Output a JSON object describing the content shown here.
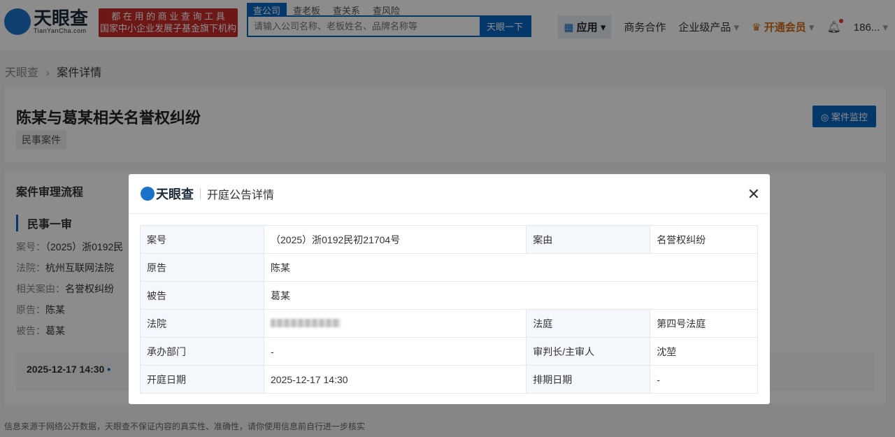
{
  "header": {
    "logo": "天眼查",
    "logo_sub": "TianYanCha.com",
    "slogan": [
      "都 在 用 的 商 业 查 询 工 具",
      "国家中小企业发展子基金旗下机构"
    ],
    "search_tabs": [
      "查公司",
      "查老板",
      "查关系",
      "查风险"
    ],
    "search_placeholder": "请输入公司名称、老板姓名、品牌名称等",
    "search_button": "天眼一下",
    "nav": {
      "app": "应用",
      "business": "商务合作",
      "enterprise": "企业级产品",
      "vip": "开通会员",
      "user": "186..."
    }
  },
  "breadcrumb": {
    "home": "天眼查",
    "current": "案件详情"
  },
  "case": {
    "title": "陈某与葛某相关名誉权纠纷",
    "tag": "民事案件",
    "monitor": "案件监控"
  },
  "process": {
    "title": "案件审理流程",
    "stage": "民事一审",
    "rows": [
      {
        "k": "案号：",
        "v": "（2025）浙0192民"
      },
      {
        "k": "法院：",
        "v": "杭州互联网法院"
      },
      {
        "k": "相关案由：",
        "v": "名誉权纠纷"
      },
      {
        "k": "原告：",
        "v": "陈某"
      },
      {
        "k": "被告：",
        "v": "葛某"
      }
    ],
    "date": "2025-12-17 14:30"
  },
  "footer": "信息来源于网络公开数据，天眼查不保证内容的真实性、准确性，请你使用信息前自行进一步核实",
  "modal": {
    "logo": "天眼查",
    "title": "开庭公告详情",
    "case_no_label": "案号",
    "case_no": "（2025）浙0192民初21704号",
    "cause_label": "案由",
    "cause": "名誉权纠纷",
    "plaintiff_label": "原告",
    "plaintiff": "陈某",
    "defendant_label": "被告",
    "defendant": "葛某",
    "court_label": "法院",
    "courtroom_label": "法庭",
    "courtroom": "第四号法庭",
    "dept_label": "承办部门",
    "dept": "-",
    "judge_label": "审判长/主审人",
    "judge": "沈堃",
    "date_label": "开庭日期",
    "date": "2025-12-17 14:30",
    "schedule_label": "排期日期",
    "schedule": "-"
  }
}
